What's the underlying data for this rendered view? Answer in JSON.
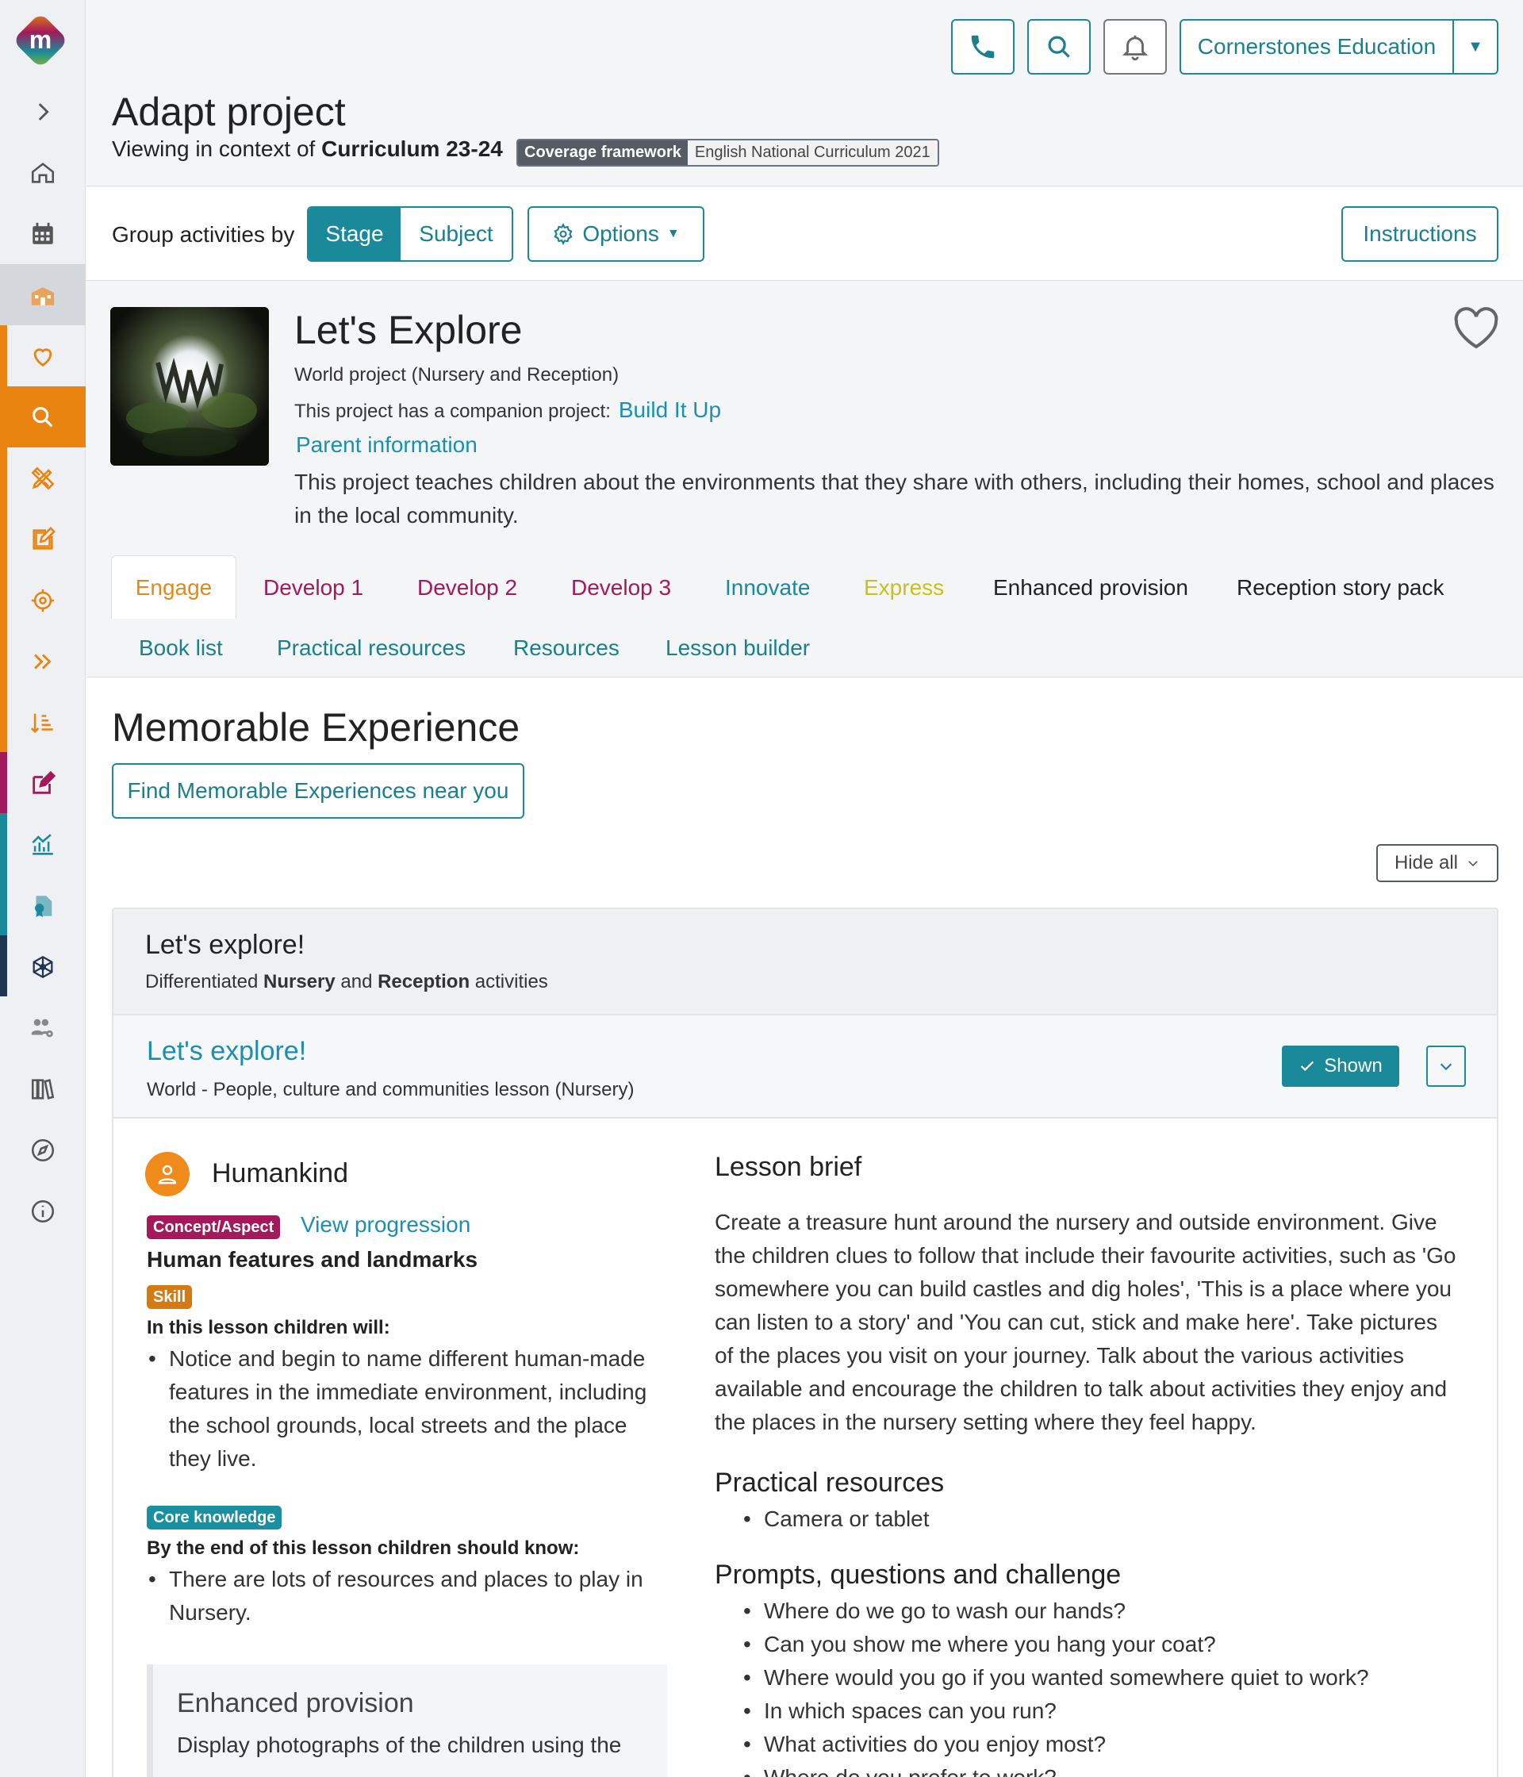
{
  "sidebar": {
    "logo_letter": "m",
    "items": [
      {
        "icon": "chevron-right-icon"
      },
      {
        "icon": "home-icon"
      },
      {
        "icon": "calendar-icon"
      },
      {
        "icon": "school-icon"
      },
      {
        "icon": "heart-icon"
      },
      {
        "icon": "search-icon"
      },
      {
        "icon": "pencil-ruler-icon"
      },
      {
        "icon": "edit-icon"
      },
      {
        "icon": "target-icon"
      },
      {
        "icon": "double-chevron-icon"
      },
      {
        "icon": "sort-list-icon"
      },
      {
        "icon": "edit-square-icon"
      },
      {
        "icon": "chart-icon"
      },
      {
        "icon": "certificate-icon"
      },
      {
        "icon": "network-icon"
      },
      {
        "icon": "users-gear-icon"
      },
      {
        "icon": "books-icon"
      },
      {
        "icon": "compass-icon"
      },
      {
        "icon": "info-icon"
      }
    ],
    "colors": {
      "accent_orange": "#e8840f",
      "accent_magenta": "#a3195b",
      "accent_teal": "#1a8a9a",
      "accent_navy": "#1f3552"
    }
  },
  "header": {
    "school": "Cornerstones Education",
    "title": "Adapt project",
    "context_prefix": "Viewing in context of",
    "context_value": "Curriculum 23-24",
    "coverage_key": "Coverage framework",
    "coverage_value": "English National Curriculum 2021"
  },
  "groupbar": {
    "label": "Group activities by",
    "stage": "Stage",
    "subject": "Subject",
    "options": "Options",
    "instructions": "Instructions"
  },
  "project": {
    "title": "Let's Explore",
    "subtitle": "World project (Nursery and Reception)",
    "companion_prefix": "This project has a companion project:",
    "companion_link": "Build It Up",
    "parent_info": "Parent information",
    "description": "This project teaches children about the environments that they share with others, including their homes, school and places in the local community."
  },
  "tabs": [
    {
      "label": "Engage",
      "color": "#e08a1e"
    },
    {
      "label": "Develop 1",
      "color": "#a3195b"
    },
    {
      "label": "Develop 2",
      "color": "#a3195b"
    },
    {
      "label": "Develop 3",
      "color": "#a3195b"
    },
    {
      "label": "Innovate",
      "color": "#1a8a9a"
    },
    {
      "label": "Express",
      "color": "#c9c21a"
    },
    {
      "label": "Enhanced provision",
      "color": "#222222"
    },
    {
      "label": "Reception story pack",
      "color": "#222222"
    },
    {
      "label": "Book list",
      "color": "#1a7f8e"
    },
    {
      "label": "Practical resources",
      "color": "#1a7f8e"
    },
    {
      "label": "Resources",
      "color": "#1a7f8e"
    },
    {
      "label": "Lesson builder",
      "color": "#1a7f8e"
    }
  ],
  "memorable": {
    "title": "Memorable Experience",
    "find_button": "Find Memorable Experiences near you",
    "hide_all": "Hide all"
  },
  "card": {
    "title": "Let's explore!",
    "sub_prefix": "Differentiated",
    "sub_nursery": "Nursery",
    "sub_and": "and",
    "sub_reception": "Reception",
    "sub_suffix": "activities"
  },
  "lesson": {
    "title": "Let's explore!",
    "subtitle": "World - People, culture and communities lesson (Nursery)",
    "shown": "Shown",
    "humankind": "Humankind",
    "concept_badge": "Concept/Aspect",
    "view_progression": "View progression",
    "feature_title": "Human features and landmarks",
    "skill_badge": "Skill",
    "will_label": "In this lesson children will:",
    "will_items": [
      "Notice and begin to name different human-made features in the immediate environment, including the school grounds, local streets and the place they live."
    ],
    "core_badge": "Core knowledge",
    "know_label": "By the end of this lesson children should know:",
    "know_items": [
      "There are lots of resources and places to play in Nursery."
    ],
    "ep_title": "Enhanced provision",
    "ep_text": "Display photographs of the children using the",
    "brief_title": "Lesson brief",
    "brief_text": "Create a treasure hunt around the nursery and outside environment. Give the children clues to follow that include their favourite activities, such as 'Go somewhere you can build castles and dig holes', 'This is a place where you can listen to a story' and 'You can cut, stick and make here'. Take pictures of the places you visit on your journey. Talk about the various activities available and encourage the children to talk about activities they enjoy and the places in the nursery setting where they feel happy.",
    "practical_title": "Practical resources",
    "practical_items": [
      "Camera or tablet"
    ],
    "prompts_title": "Prompts, questions and challenge",
    "prompts_items": [
      "Where do we go to wash our hands?",
      "Can you show me where you hang your coat?",
      "Where would you go if you wanted somewhere quiet to work?",
      "In which spaces can you run?",
      "What activities do you enjoy most?",
      "Where do you prefer to work?"
    ]
  }
}
